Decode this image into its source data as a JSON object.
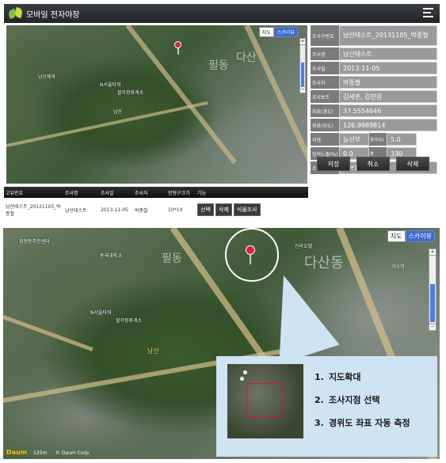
{
  "app": {
    "title": "모바일 전자야장"
  },
  "map_top": {
    "switch": {
      "map": "지도",
      "satellite": "스카이뷰"
    },
    "labels": [
      "남산",
      "필동",
      "다산",
      "남산체육",
      "팔각정휴게소",
      "N서울타워"
    ]
  },
  "form": {
    "survey_id": {
      "label": "조사구번호",
      "value": "남산테스트_20131105_박종철"
    },
    "survey_name": {
      "label": "조사명",
      "value": "남산테스트"
    },
    "survey_date": {
      "label": "조사일",
      "value": "2013-11-05"
    },
    "surveyor": {
      "label": "조사자",
      "value": "박종철"
    },
    "assistant": {
      "label": "조사보조",
      "value": "김세훈, 김진원"
    },
    "lat": {
      "label": "좌표(경도)",
      "value": "37.5554646"
    },
    "lon": {
      "label": "좌표(위도)",
      "value": "126.9989814"
    },
    "terrain": {
      "label": "지형",
      "value": "능선부",
      "sub_label": "경사(도)",
      "sub_value": "5.0"
    },
    "altitude": {
      "label": "암석노출(%)",
      "value": "0.0",
      "sub_label": "향",
      "sub_value": "330"
    },
    "plot_size": {
      "label": "조사구크기",
      "value": "10*10"
    }
  },
  "buttons": {
    "save": "저장",
    "cancel": "취소",
    "delete": "삭제"
  },
  "table": {
    "headers": [
      "고유번호",
      "조사명",
      "조사일",
      "조사자",
      "방형구크기",
      "기능"
    ],
    "rows": [
      {
        "id": "남산테스트_20131105_박종철",
        "name": "남산테스트",
        "date": "2013-11-05",
        "surveyor": "박종철",
        "size": "10*10",
        "actions": [
          "선택",
          "삭제",
          "식물조사"
        ]
      }
    ]
  },
  "map_bottom": {
    "switch": {
      "map": "지도",
      "satellite": "스카이뷰"
    },
    "labels": [
      "필동",
      "다산동",
      "약수역",
      "남산",
      "N서울타워",
      "팔각정휴게소",
      "회현동주민센터",
      "신라호텔",
      "동국대학교"
    ],
    "logo": "Daum",
    "scale": "125m",
    "copyright": "© Daum Corp."
  },
  "callout": {
    "steps": [
      {
        "num": "1.",
        "text": "지도확대"
      },
      {
        "num": "2.",
        "text": "조사지점 선택"
      },
      {
        "num": "3.",
        "text": "경위도 좌표 자동 측정"
      }
    ]
  }
}
